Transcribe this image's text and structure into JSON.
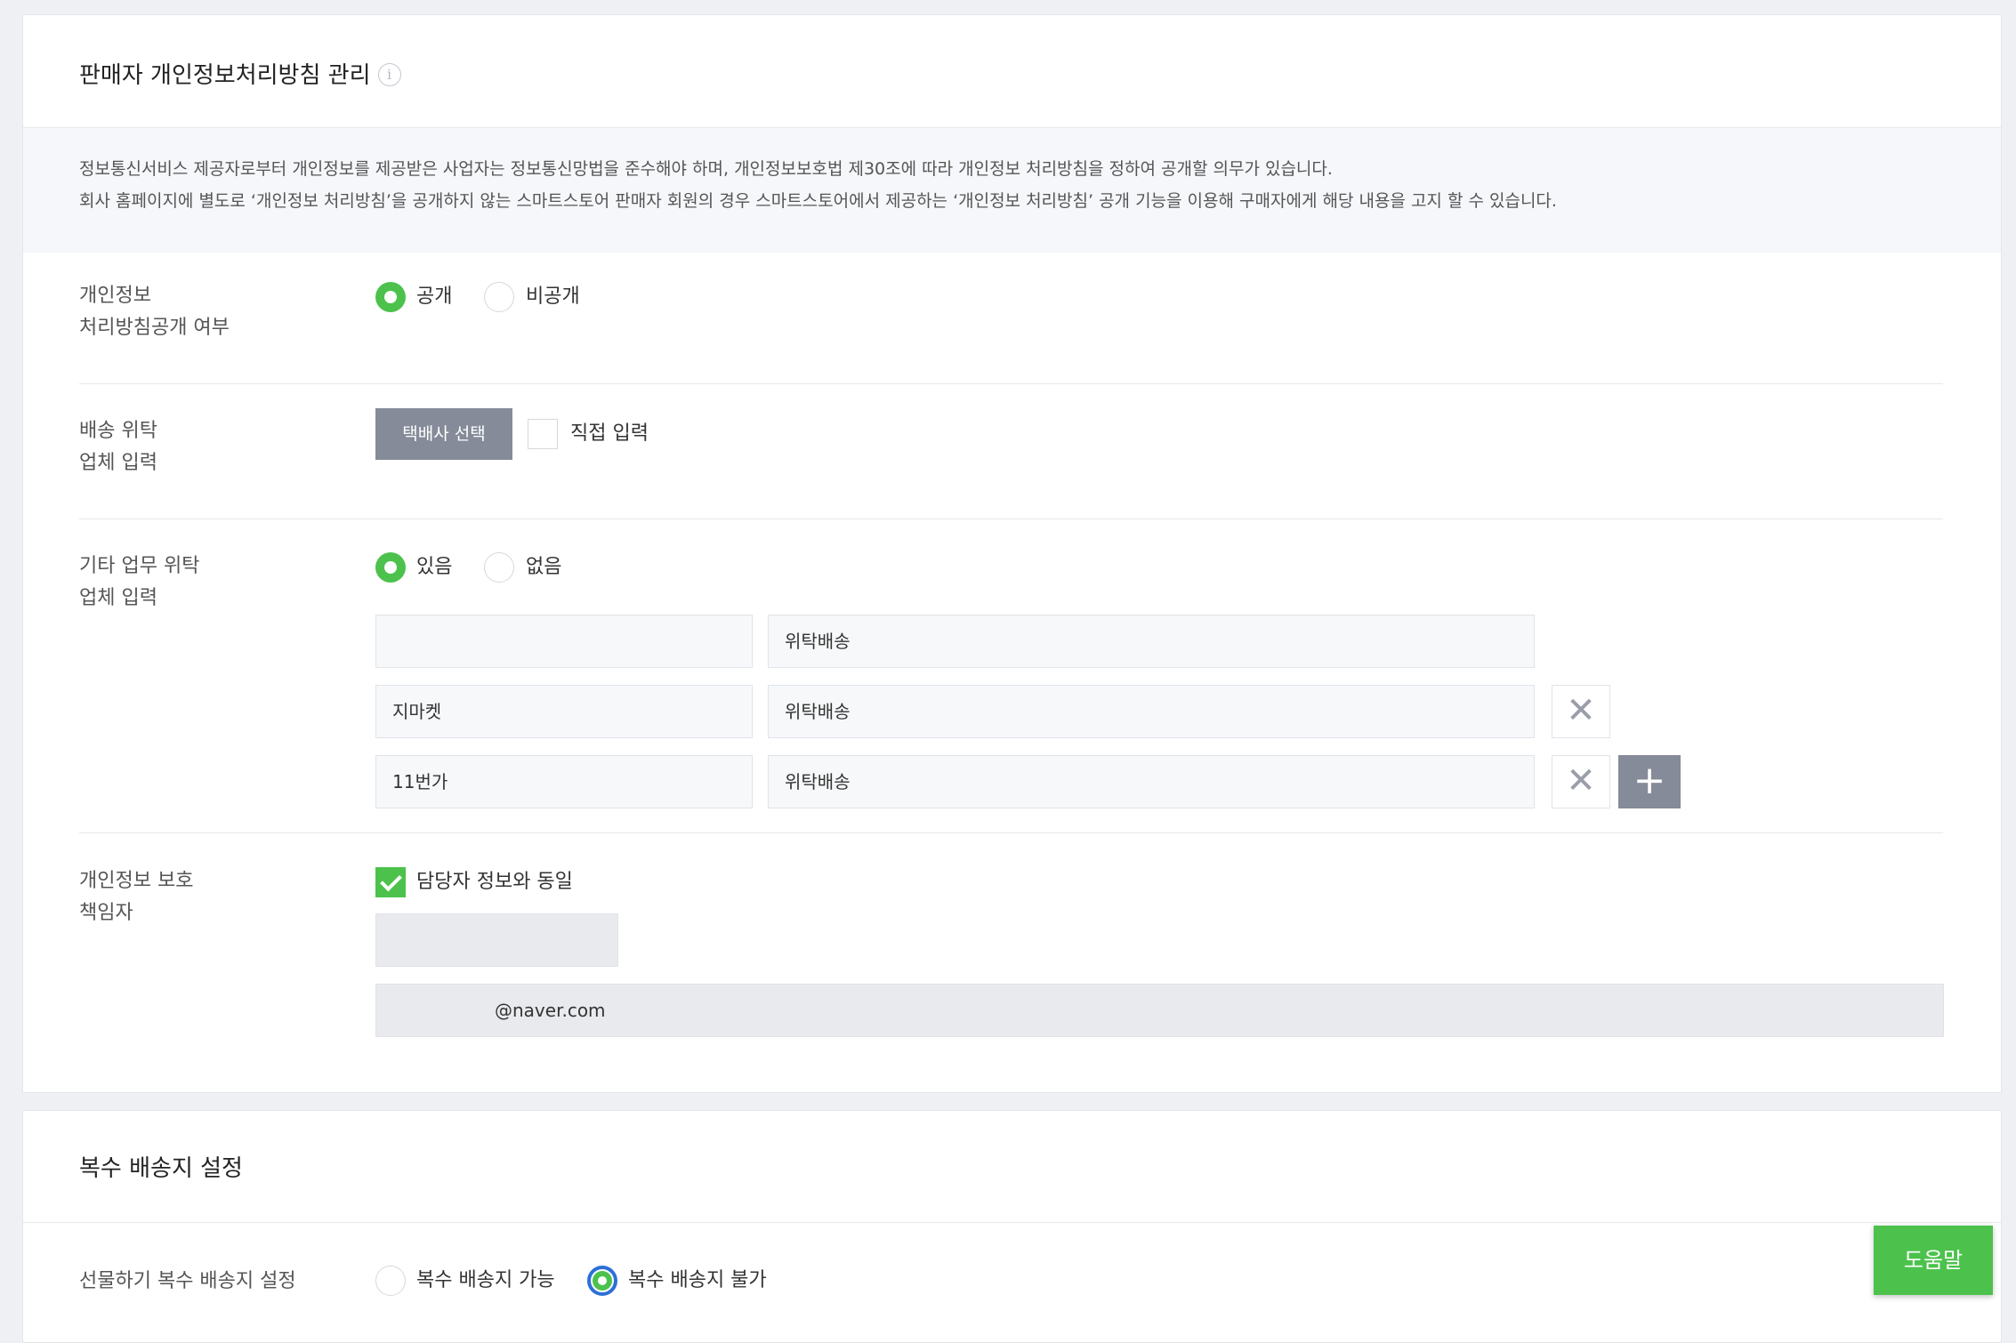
{
  "privacy_section": {
    "title": "판매자 개인정보처리방침 관리",
    "info_icon": "i",
    "notice": {
      "line1": "정보통신서비스 제공자로부터 개인정보를 제공받은 사업자는 정보통신망법을 준수해야 하며, 개인정보보호법 제30조에 따라 개인정보 처리방침을 정하여 공개할 의무가 있습니다.",
      "line2": "회사 홈페이지에 별도로 ‘개인정보 처리방침’을 공개하지 않는 스마트스토어 판매자 회원의 경우 스마트스토어에서 제공하는 ‘개인정보 처리방침’ 공개 기능을 이용해 구매자에게 해당 내용을 고지 할 수 있습니다."
    },
    "disclosure": {
      "label_line1": "개인정보",
      "label_line2": "처리방침공개 여부",
      "options": [
        "공개",
        "비공개"
      ],
      "selected": "공개"
    },
    "delivery_consignment": {
      "label_line1": "배송 위탁",
      "label_line2": "업체 입력",
      "select_button": "택배사 선택",
      "direct_input_label": "직접 입력",
      "direct_input_checked": false
    },
    "other_consignment": {
      "label_line1": "기타 업무 위탁",
      "label_line2": "업체 입력",
      "options": [
        "있음",
        "없음"
      ],
      "selected": "있음",
      "rows": [
        {
          "company": "",
          "task": "위탁배송"
        },
        {
          "company": "지마켓",
          "task": "위탁배송"
        },
        {
          "company": "11번가",
          "task": "위탁배송"
        }
      ],
      "remove_icon": "✕",
      "add_icon": "+"
    },
    "privacy_officer": {
      "label_line1": "개인정보 보호",
      "label_line2": "책임자",
      "same_as_contact_label": "담당자 정보와 동일",
      "same_as_contact_checked": true,
      "name_value": "",
      "email_value": "@naver.com"
    }
  },
  "multi_address_section": {
    "title": "복수 배송지 설정",
    "label": "선물하기 복수 배송지 설정",
    "options": [
      "복수 배송지 가능",
      "복수 배송지 불가"
    ],
    "selected": "복수 배송지 불가"
  },
  "help_button": "도움말",
  "colors": {
    "accent_green": "#4cc24c",
    "button_gray": "#858b98",
    "focus_ring": "#2d6fd8"
  }
}
